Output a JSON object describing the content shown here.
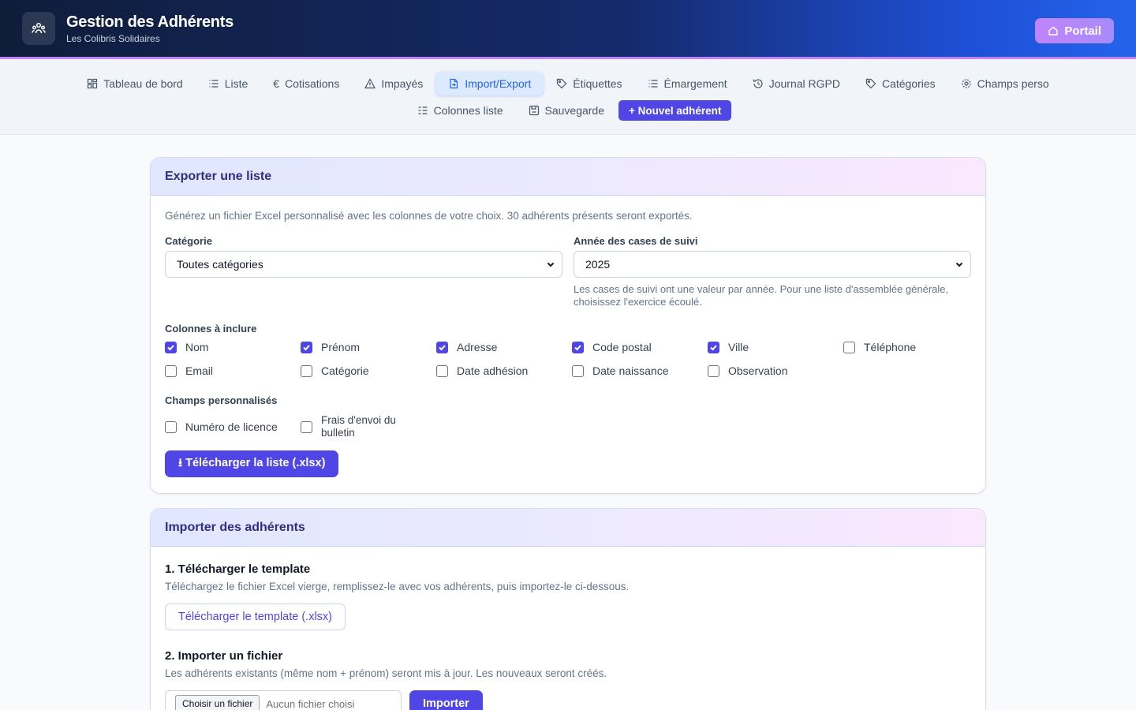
{
  "app": {
    "title": "Gestion des Adhérents",
    "subtitle": "Les Colibris Solidaires",
    "portal_label": "Portail",
    "accent": "#4f46e5",
    "logo_icon": "members-icon"
  },
  "nav": {
    "row1": [
      {
        "label": "Tableau de bord",
        "icon": "dashboard-icon"
      },
      {
        "label": "Liste",
        "icon": "list-icon"
      },
      {
        "label": "Cotisations",
        "icon": "euro-icon"
      },
      {
        "label": "Impayés",
        "icon": "warning-icon"
      },
      {
        "label": "Import/Export",
        "icon": "file-transfer-icon",
        "active": true
      },
      {
        "label": "Étiquettes",
        "icon": "tag-icon"
      },
      {
        "label": "Émargement",
        "icon": "list-icon"
      },
      {
        "label": "Journal RGPD",
        "icon": "history-icon"
      },
      {
        "label": "Catégories",
        "icon": "tag-icon"
      },
      {
        "label": "Champs perso",
        "icon": "gear-icon"
      }
    ],
    "row2": [
      {
        "label": "Colonnes liste",
        "icon": "columns-icon"
      },
      {
        "label": "Sauvegarde",
        "icon": "save-icon"
      }
    ],
    "new_member_label": "+ Nouvel adhérent"
  },
  "export": {
    "title": "Exporter une liste",
    "description": "Générez un fichier Excel personnalisé avec les colonnes de votre choix. 30 adhérents présents seront exportés.",
    "category_label": "Catégorie",
    "category_value": "Toutes catégories",
    "year_label": "Année des cases de suivi",
    "year_value": "2025",
    "year_hint": "Les cases de suivi ont une valeur par année. Pour une liste d'assemblée générale, choisissez l'exercice écoulé.",
    "columns_label": "Colonnes à inclure",
    "columns": [
      {
        "label": "Nom",
        "checked": true
      },
      {
        "label": "Prénom",
        "checked": true
      },
      {
        "label": "Adresse",
        "checked": true
      },
      {
        "label": "Code postal",
        "checked": true
      },
      {
        "label": "Ville",
        "checked": true
      },
      {
        "label": "Téléphone",
        "checked": false
      },
      {
        "label": "Email",
        "checked": false
      },
      {
        "label": "Catégorie",
        "checked": false
      },
      {
        "label": "Date adhésion",
        "checked": false
      },
      {
        "label": "Date naissance",
        "checked": false
      },
      {
        "label": "Observation",
        "checked": false
      }
    ],
    "custom_label": "Champs personnalisés",
    "custom_fields": [
      {
        "label": "Numéro de licence",
        "checked": false
      },
      {
        "label": "Frais d'envoi du bulletin",
        "checked": false
      }
    ],
    "download_label": "⭳ Télécharger la liste (.xlsx)"
  },
  "import": {
    "title": "Importer des adhérents",
    "step1_title": "1. Télécharger le template",
    "step1_desc": "Téléchargez le fichier Excel vierge, remplissez-le avec vos adhérents, puis importez-le ci-dessous.",
    "template_button": "Télécharger le template (.xlsx)",
    "step2_title": "2. Importer un fichier",
    "step2_desc": "Les adhérents existants (même nom + prénom) seront mis à jour. Les nouveaux seront créés.",
    "file_button": "Choisir un fichier",
    "file_placeholder": "Aucun fichier choisi",
    "import_button": "Importer"
  }
}
